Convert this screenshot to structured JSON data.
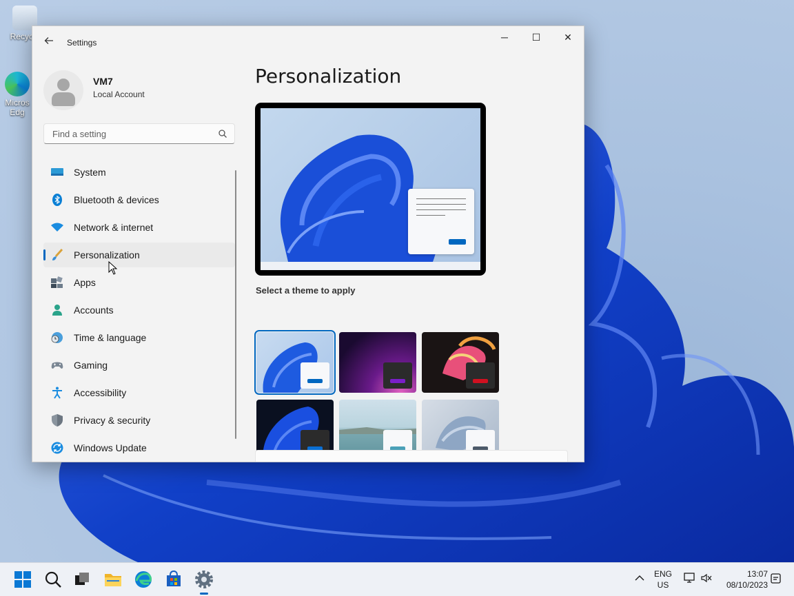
{
  "desktop": {
    "icons": [
      {
        "label": "Recycle"
      },
      {
        "label": "Micros Edg"
      }
    ]
  },
  "window": {
    "title": "Settings",
    "back_icon": "arrow-left-icon",
    "controls": {
      "minimize": "─",
      "maximize": "☐",
      "close": "✕"
    }
  },
  "profile": {
    "name": "VM7",
    "subtitle": "Local Account"
  },
  "search": {
    "placeholder": "Find a setting"
  },
  "nav": {
    "items": [
      {
        "label": "System",
        "icon": "monitor-icon"
      },
      {
        "label": "Bluetooth & devices",
        "icon": "bluetooth-icon"
      },
      {
        "label": "Network & internet",
        "icon": "wifi-icon"
      },
      {
        "label": "Personalization",
        "icon": "brush-icon",
        "active": true
      },
      {
        "label": "Apps",
        "icon": "apps-icon"
      },
      {
        "label": "Accounts",
        "icon": "person-icon"
      },
      {
        "label": "Time & language",
        "icon": "clock-globe-icon"
      },
      {
        "label": "Gaming",
        "icon": "gamepad-icon"
      },
      {
        "label": "Accessibility",
        "icon": "accessibility-icon"
      },
      {
        "label": "Privacy & security",
        "icon": "shield-icon"
      },
      {
        "label": "Windows Update",
        "icon": "update-icon"
      }
    ]
  },
  "main": {
    "title": "Personalization",
    "themes_label": "Select a theme to apply",
    "themes": [
      {
        "name": "light-bloom",
        "selected": true
      },
      {
        "name": "glow"
      },
      {
        "name": "captured-motion"
      },
      {
        "name": "dark-bloom"
      },
      {
        "name": "sunrise-lake"
      },
      {
        "name": "flow"
      }
    ]
  },
  "taskbar": {
    "language_top": "ENG",
    "language_bottom": "US",
    "time": "13:07",
    "date": "08/10/2023"
  },
  "colors": {
    "accent": "#0067c0",
    "window_bg": "#f3f3f3"
  }
}
